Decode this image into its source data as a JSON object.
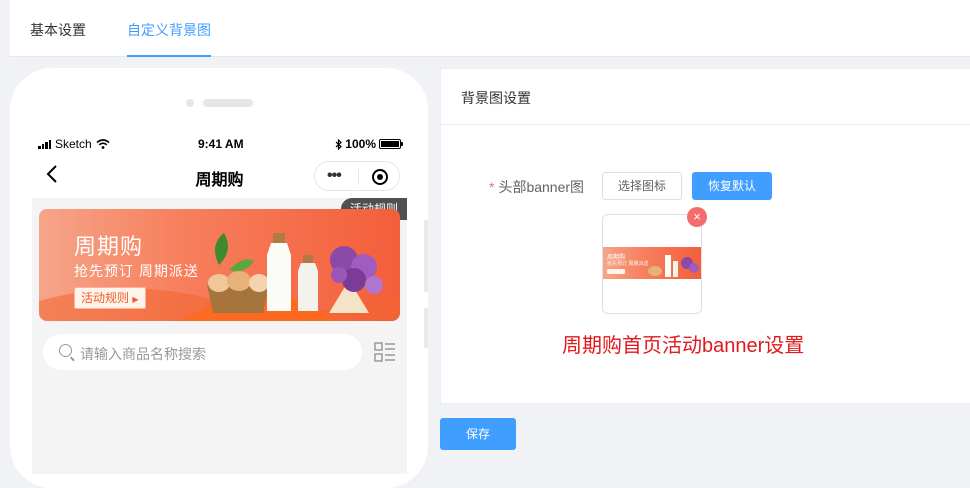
{
  "tabs": [
    {
      "label": "基本设置",
      "active": false
    },
    {
      "label": "自定义背景图",
      "active": true
    }
  ],
  "phone": {
    "status_bar": {
      "carrier": "Sketch",
      "time": "9:41 AM",
      "battery": "100%"
    },
    "nav_title": "周期购",
    "rules_tag": "活动规则",
    "banner": {
      "title": "周期购",
      "subtitle": "抢先预订 周期派送",
      "button_label": "活动规则"
    },
    "search_placeholder": "请输入商品名称搜索"
  },
  "settings": {
    "card_title": "背景图设置",
    "field_label": "头部banner图",
    "choose_button": "选择图标",
    "reset_button": "恢复默认",
    "annotation": "周期购首页活动banner设置",
    "thumb_banner_title": "周期购",
    "thumb_banner_sub": "抢先预订 周期派送"
  },
  "save_button": "保存",
  "colors": {
    "primary": "#409eff",
    "danger": "#f56c6c",
    "annotation": "#e0191c",
    "banner_orange": "#f45e3a"
  }
}
